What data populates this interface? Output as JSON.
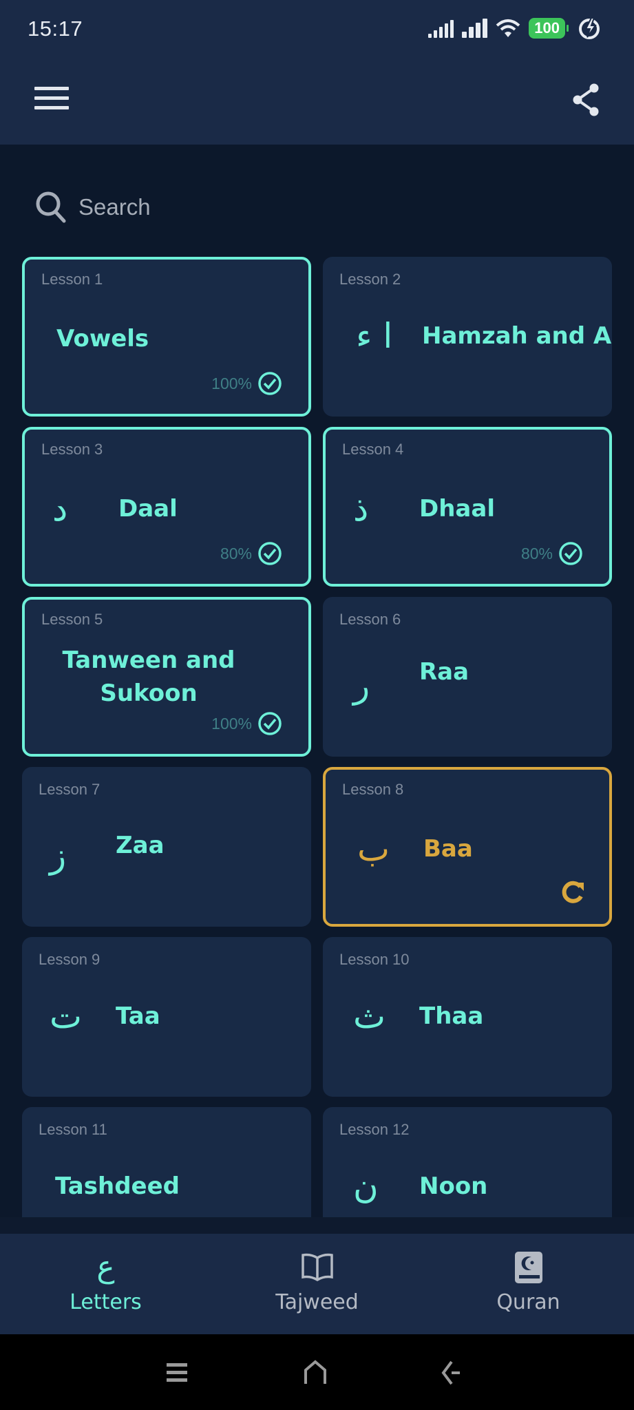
{
  "status_bar": {
    "time": "15:17",
    "battery": "100"
  },
  "app_bar": {
    "menu_icon": "hamburger-menu-icon",
    "share_icon": "share-icon"
  },
  "search": {
    "placeholder": "Search",
    "icon": "search-icon"
  },
  "colors": {
    "accent": "#6ef0d8",
    "active": "#d9a73e",
    "card_bg": "#182a46",
    "page_bg": "#0c182b",
    "bar_bg": "#1a2a47"
  },
  "lessons": [
    {
      "label": "Lesson 1",
      "letter": "",
      "title": "Vowels",
      "state": "completed",
      "progress": "100%"
    },
    {
      "label": "Lesson 2",
      "letter": "ا ء",
      "title": "Hamzah and Ali",
      "state": "locked",
      "progress": ""
    },
    {
      "label": "Lesson 3",
      "letter": "د",
      "title": "Daal",
      "state": "completed",
      "progress": "80%"
    },
    {
      "label": "Lesson 4",
      "letter": "ذ",
      "title": "Dhaal",
      "state": "completed",
      "progress": "80%"
    },
    {
      "label": "Lesson 5",
      "letter": "",
      "title": "Tanween and Sukoon",
      "state": "completed",
      "progress": "100%"
    },
    {
      "label": "Lesson 6",
      "letter": "ر",
      "title": "Raa",
      "state": "locked",
      "progress": ""
    },
    {
      "label": "Lesson 7",
      "letter": "ز",
      "title": "Zaa",
      "state": "locked",
      "progress": ""
    },
    {
      "label": "Lesson 8",
      "letter": "ب",
      "title": "Baa",
      "state": "in-progress",
      "progress": ""
    },
    {
      "label": "Lesson 9",
      "letter": "ت",
      "title": "Taa",
      "state": "locked",
      "progress": ""
    },
    {
      "label": "Lesson 10",
      "letter": "ث",
      "title": "Thaa",
      "state": "locked",
      "progress": ""
    },
    {
      "label": "Lesson 11",
      "letter": "",
      "title": "Tashdeed",
      "state": "locked",
      "progress": ""
    },
    {
      "label": "Lesson 12",
      "letter": "ن",
      "title": "Noon",
      "state": "locked",
      "progress": ""
    }
  ],
  "bottom_nav": [
    {
      "label": "Letters",
      "icon": "arabic-letter-ain-icon",
      "glyph": "ع",
      "selected": true
    },
    {
      "label": "Tajweed",
      "icon": "open-book-icon",
      "selected": false
    },
    {
      "label": "Quran",
      "icon": "quran-book-icon",
      "selected": false
    }
  ],
  "system_nav": [
    "recents-icon",
    "home-icon",
    "back-icon"
  ]
}
